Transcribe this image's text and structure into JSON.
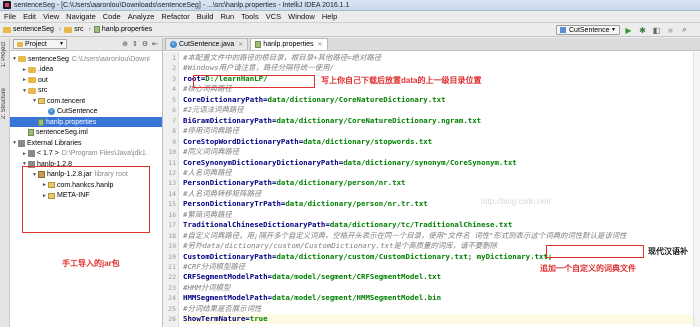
{
  "window": {
    "title": "sentenceSeg - [C:\\Users\\aaronlou\\Downloads\\sentenceSeg] - ...\\src\\hanlp.properties - IntelliJ IDEA 2016.1.1"
  },
  "menu": [
    "File",
    "Edit",
    "View",
    "Navigate",
    "Code",
    "Analyze",
    "Refactor",
    "Build",
    "Run",
    "Tools",
    "VCS",
    "Window",
    "Help"
  ],
  "breadcrumb": [
    "sentenceSeg",
    "src",
    "hanlp.properties"
  ],
  "run_config": "CutSentence",
  "side_tabs": [
    "1: Project",
    "2: Structure"
  ],
  "project_panel": {
    "title": "Project",
    "tree": [
      {
        "label": "sentenceSeg",
        "extra": "C:\\Users\\aaronlou\\Downl",
        "icon": "folder",
        "arrow": "▼"
      },
      {
        "label": ".idea",
        "extra": "",
        "icon": "folder",
        "arrow": "►"
      },
      {
        "label": "out",
        "extra": "",
        "icon": "folder",
        "arrow": "►"
      },
      {
        "label": "src",
        "extra": "",
        "icon": "folder",
        "arrow": "▼"
      },
      {
        "label": "com.tencent",
        "extra": "",
        "icon": "package",
        "arrow": "▼"
      },
      {
        "label": "CutSentence",
        "extra": "",
        "icon": "class",
        "arrow": ""
      },
      {
        "label": "hanlp.properties",
        "extra": "",
        "icon": "file",
        "arrow": ""
      },
      {
        "label": "sentenceSeg.iml",
        "extra": "",
        "icon": "file",
        "arrow": ""
      },
      {
        "label": "External Libraries",
        "extra": "",
        "icon": "lib",
        "arrow": "▼"
      },
      {
        "label": "< 1.7 >",
        "extra": "D:\\Program Files\\Java\\jdk1.",
        "icon": "lib",
        "arrow": "►"
      },
      {
        "label": "hanlp-1.2.8",
        "extra": "",
        "icon": "lib",
        "arrow": "▼"
      },
      {
        "label": "hanlp-1.2.8.jar",
        "extra": "library root",
        "icon": "jar",
        "arrow": "▼"
      },
      {
        "label": "com.hankcs.hanlp",
        "extra": "",
        "icon": "package",
        "arrow": "►"
      },
      {
        "label": "META-INF",
        "extra": "",
        "icon": "package",
        "arrow": "►"
      }
    ]
  },
  "annotations": {
    "jar_note": "手工导入的jar包",
    "root_note": "写上你自己下载后放置data的上一级目录位置",
    "dict_note": "追加一个自定义的词典文件",
    "dict_edge": "现代汉语补"
  },
  "tabs": [
    {
      "label": "CutSentence.java"
    },
    {
      "label": "hanlp.properties"
    }
  ],
  "code_lines": [
    {
      "n": "1",
      "type": "comment",
      "text": "#本配置文件中的路径的根目录，根目录+其他路径=绝对路径"
    },
    {
      "n": "2",
      "type": "comment",
      "text": "#Windows用户请注意，路径分隔符统一使用/"
    },
    {
      "n": "3",
      "type": "kv",
      "key": "root",
      "value": "D:/learnHanLP/"
    },
    {
      "n": "4",
      "type": "comment",
      "text": "#核心词典路径"
    },
    {
      "n": "5",
      "type": "kv",
      "key": "CoreDictionaryPath",
      "value": "data/dictionary/CoreNatureDictionary.txt"
    },
    {
      "n": "6",
      "type": "comment",
      "text": "#2元语法词典路径"
    },
    {
      "n": "7",
      "type": "kv",
      "key": "BiGramDictionaryPath",
      "value": "data/dictionary/CoreNatureDictionary.ngram.txt"
    },
    {
      "n": "8",
      "type": "comment",
      "text": "#停用词词典路径"
    },
    {
      "n": "9",
      "type": "kv",
      "key": "CoreStopWordDictionaryPath",
      "value": "data/dictionary/stopwords.txt"
    },
    {
      "n": "10",
      "type": "comment",
      "text": "#同义词词典路径"
    },
    {
      "n": "11",
      "type": "kv",
      "key": "CoreSynonymDictionaryDictionaryPath",
      "value": "data/dictionary/synonym/CoreSynonym.txt"
    },
    {
      "n": "12",
      "type": "comment",
      "text": "#人名词典路径"
    },
    {
      "n": "13",
      "type": "kv",
      "key": "PersonDictionaryPath",
      "value": "data/dictionary/person/nr.txt"
    },
    {
      "n": "14",
      "type": "comment",
      "text": "#人名词典转移矩阵路径"
    },
    {
      "n": "15",
      "type": "kv",
      "key": "PersonDictionaryTrPath",
      "value": "data/dictionary/person/nr.tr.txt"
    },
    {
      "n": "16",
      "type": "comment",
      "text": "#繁简词典路径"
    },
    {
      "n": "17",
      "type": "kv",
      "key": "TraditionalChineseDictionaryPath",
      "value": "data/dictionary/tc/TraditionalChinese.txt"
    },
    {
      "n": "18",
      "type": "comment",
      "text": "#自定义词典路径，用;隔开多个自定义词典，空格开头表示在同一个目录，使用\"文件名 词性\"形式则表示这个词典的词性默认是该词性"
    },
    {
      "n": "19",
      "type": "comment",
      "text": "#另外data/dictionary/custom/CustomDictionary.txt是个高质量的词库，请不要删除"
    },
    {
      "n": "20",
      "type": "kv",
      "key": "CustomDictionaryPath",
      "value": "data/dictionary/custom/CustomDictionary.txt; myDictionary.txt;"
    },
    {
      "n": "21",
      "type": "comment",
      "text": "#CRF分词模型路径"
    },
    {
      "n": "22",
      "type": "kv",
      "key": "CRFSegmentModelPath",
      "value": "data/model/segment/CRFSegmentModel.txt"
    },
    {
      "n": "23",
      "type": "comment",
      "text": "#HMM分词模型"
    },
    {
      "n": "24",
      "type": "kv",
      "key": "HMMSegmentModelPath",
      "value": "data/model/segment/HMMSegmentModel.bin"
    },
    {
      "n": "25",
      "type": "comment",
      "text": "#分词结果是否展示词性"
    },
    {
      "n": "26",
      "type": "kv",
      "key": "ShowTermNature",
      "value": "true"
    }
  ],
  "watermark": "http://blog.csdn.net/",
  "colors": {
    "selection": "#3875d7",
    "annotation": "#e03030",
    "key": "#000080",
    "value": "#008000",
    "comment": "#808080"
  }
}
